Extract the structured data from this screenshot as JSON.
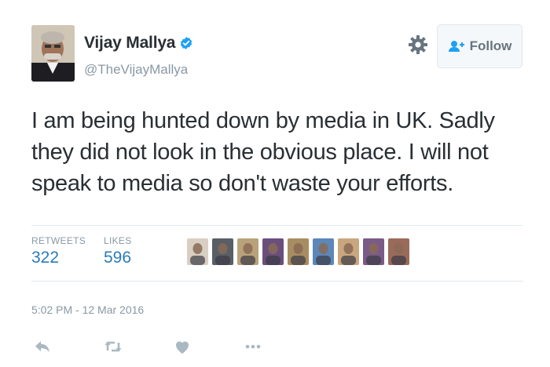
{
  "user": {
    "name": "Vijay Mallya",
    "handle": "@TheVijayMallya"
  },
  "follow_label": "Follow",
  "tweet_text": "I am being hunted down by media in UK. Sadly they did not look in the obvious place. I will not speak to media so don't waste your efforts.",
  "stats": {
    "retweets_label": "RETWEETS",
    "retweets": "322",
    "likes_label": "LIKES",
    "likes": "596"
  },
  "likers": [
    {
      "color": "#d8cfc2"
    },
    {
      "color": "#5a5f66"
    },
    {
      "color": "#b9a27a"
    },
    {
      "color": "#6a4f7d"
    },
    {
      "color": "#a88d62"
    },
    {
      "color": "#5c87b8"
    },
    {
      "color": "#c9a77e"
    },
    {
      "color": "#7a5a86"
    },
    {
      "color": "#9a6a5a"
    }
  ],
  "timestamp": "5:02 PM - 12 Mar 2016",
  "colors": {
    "link_blue": "#2b7bb9",
    "verified_blue": "#1da1f2",
    "muted_gray": "#8899a6",
    "icon_gray": "#aab8c2"
  },
  "actions": [
    "reply-icon",
    "retweet-icon",
    "like-icon",
    "more-icon"
  ]
}
